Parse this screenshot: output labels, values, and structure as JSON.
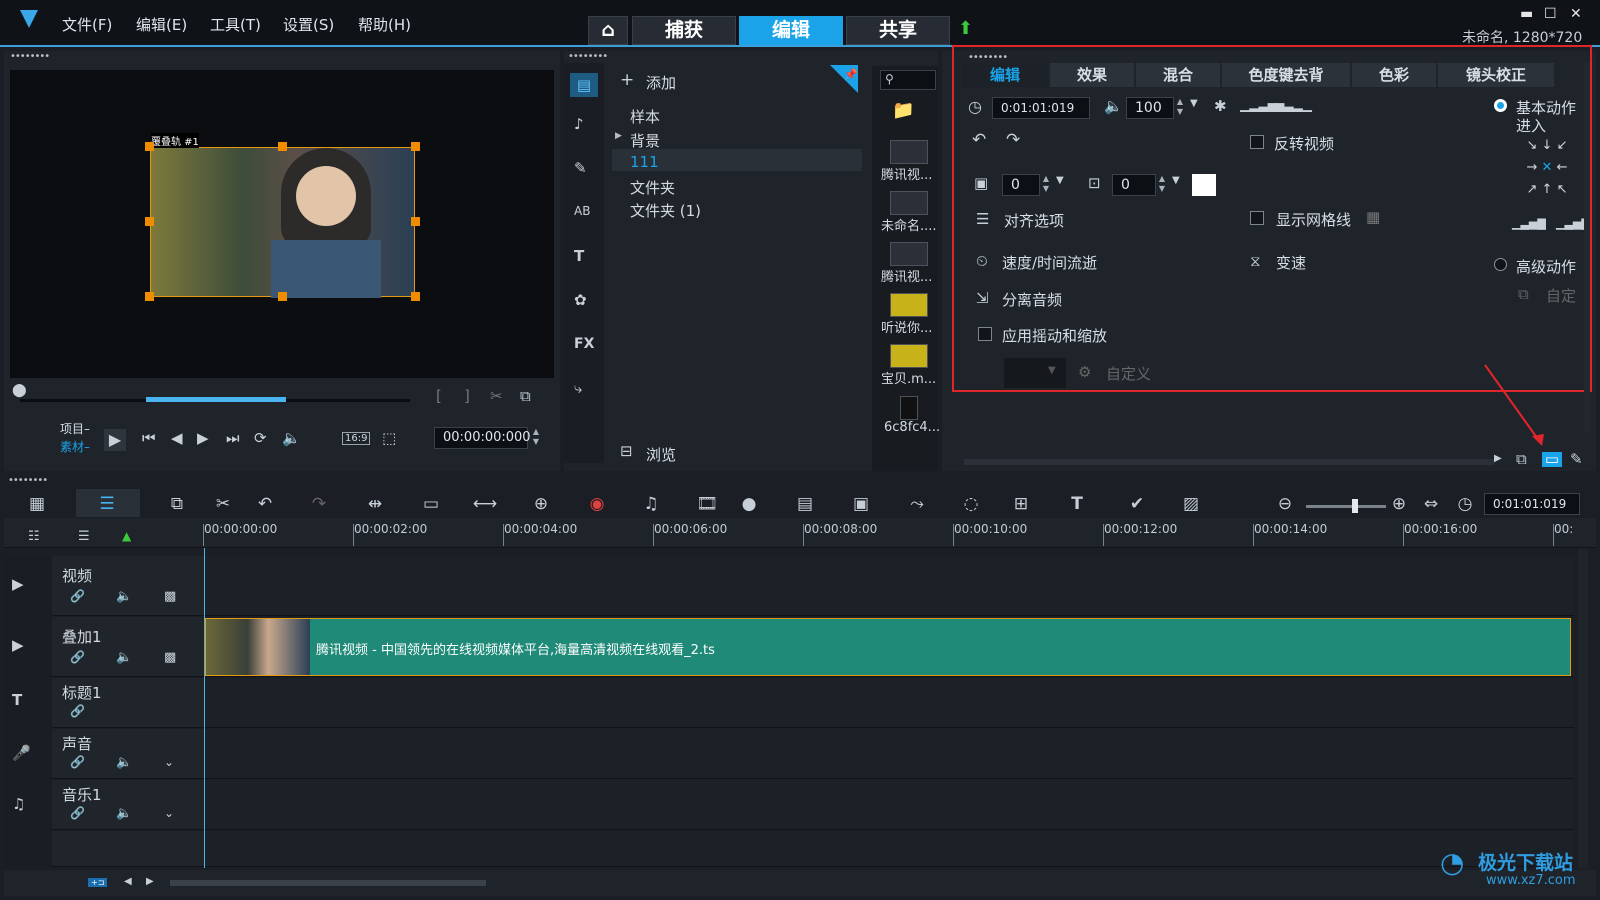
{
  "menu": [
    "文件(F)",
    "编辑(E)",
    "工具(T)",
    "设置(S)",
    "帮助(H)"
  ],
  "main_tabs": {
    "capture": "捕获",
    "edit": "编辑",
    "share": "共享"
  },
  "project_info": "未命名, 1280*720",
  "preview": {
    "overlay_label": "覆叠轨 #1",
    "project_label": "项目–",
    "clip_label": "素材–",
    "timecode": "00:00:00:000",
    "aspect": "16:9"
  },
  "library": {
    "add_label": "添加",
    "folders": [
      "样本",
      "背景",
      "111",
      "文件夹",
      "文件夹 (1)"
    ],
    "selected_folder": "111",
    "browse_label": "浏览",
    "thumbs": [
      "腾讯视...",
      "未命名....",
      "腾讯视...",
      "听说你...",
      "宝贝.m...",
      "6c8fc4..."
    ]
  },
  "options": {
    "tabs": [
      "编辑",
      "效果",
      "混合",
      "色度键去背",
      "色彩",
      "镜头校正"
    ],
    "active_tab": "编辑",
    "duration": "0:01:01:019",
    "volume": "100",
    "reverse_video": "反转视频",
    "rotate_a": "0",
    "rotate_b": "0",
    "align_options": "对齐选项",
    "show_grid": "显示网格线",
    "speed_time_lapse": "速度/时间流逝",
    "variable_speed": "变速",
    "split_audio": "分离音频",
    "pan_zoom": "应用摇动和缩放",
    "custom": "自定义",
    "basic_motion": "基本动作",
    "enter": "进入",
    "advanced_motion": "高级动作",
    "custom2": "自定",
    "accent_color": "#1aa3e8",
    "highlight_border": "#e0262b"
  },
  "timeline": {
    "ruler": [
      "00:00:00:00",
      "00:00:02:00",
      "00:00:04:00",
      "00:00:06:00",
      "00:00:08:00",
      "00:00:10:00",
      "00:00:12:00",
      "00:00:14:00",
      "00:00:16:00",
      "00:"
    ],
    "timecode": "0:01:01:019",
    "tracks": [
      "视频",
      "叠加1",
      "标题1",
      "声音",
      "音乐1"
    ],
    "clip_title": "腾讯视频 - 中国领先的在线视频媒体平台,海量高清视频在线观看_2.ts",
    "clip_color": "#1e8a77"
  },
  "watermark": {
    "cn": "极光下载站",
    "url": "www.xz7.com"
  }
}
